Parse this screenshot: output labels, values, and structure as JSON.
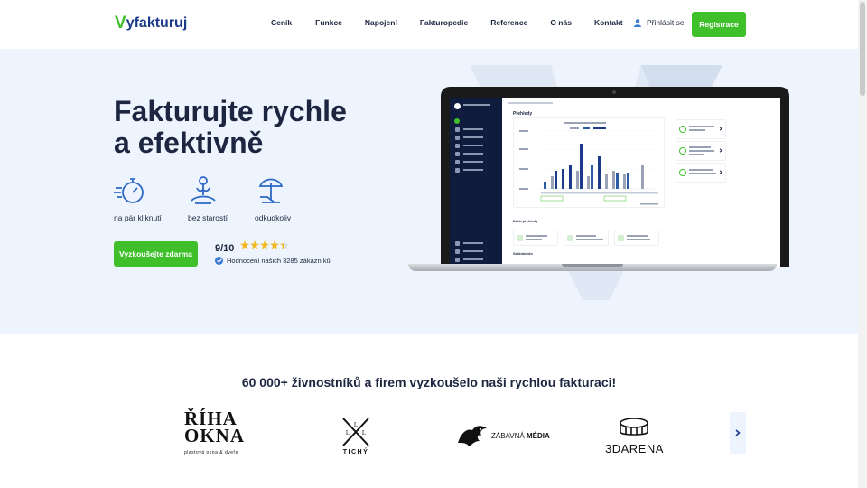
{
  "brand": {
    "logo_mark": "V",
    "logo_text": "yfakturuj",
    "accent": "#3fc02b",
    "navy": "#1c2640"
  },
  "nav": {
    "items": [
      "Ceník",
      "Funkce",
      "Napojení",
      "Fakturopedie",
      "Reference",
      "O nás",
      "Kontakt"
    ]
  },
  "header": {
    "login_label": "Přihlásit se",
    "register_label": "Registrace"
  },
  "hero": {
    "title_line1": "Fakturujte rychle",
    "title_line2": "a efektivně",
    "features": [
      "na pár kliknutí",
      "bez starostí",
      "odkudkoliv"
    ],
    "cta_label": "Vyzkoušejte zdarma",
    "rating_score": "9/10",
    "rating_stars": 4.5,
    "rating_note": "Hodnocení našich 3285 zákazníků"
  },
  "app_preview": {
    "page_heading": "Přehledy",
    "section_heading": "Další přehledy",
    "section_heading2": "Saldokonto"
  },
  "trust": {
    "title": "60 000+ živnostníků a firem vyzkoušelo naši rychlou fakturaci!",
    "logos": [
      {
        "name": "riha-okna",
        "line1": "ŘÍHA",
        "line2": "OKNA",
        "tagline": "plastová okna & dveře"
      },
      {
        "name": "tichy",
        "letters": "L L L",
        "text": "TICHÝ"
      },
      {
        "name": "zabavna-media",
        "text_plain": "ZÁBAVNÁ ",
        "text_bold": "MÉDIA"
      },
      {
        "name": "3darena",
        "text": "3DARENA"
      }
    ]
  }
}
